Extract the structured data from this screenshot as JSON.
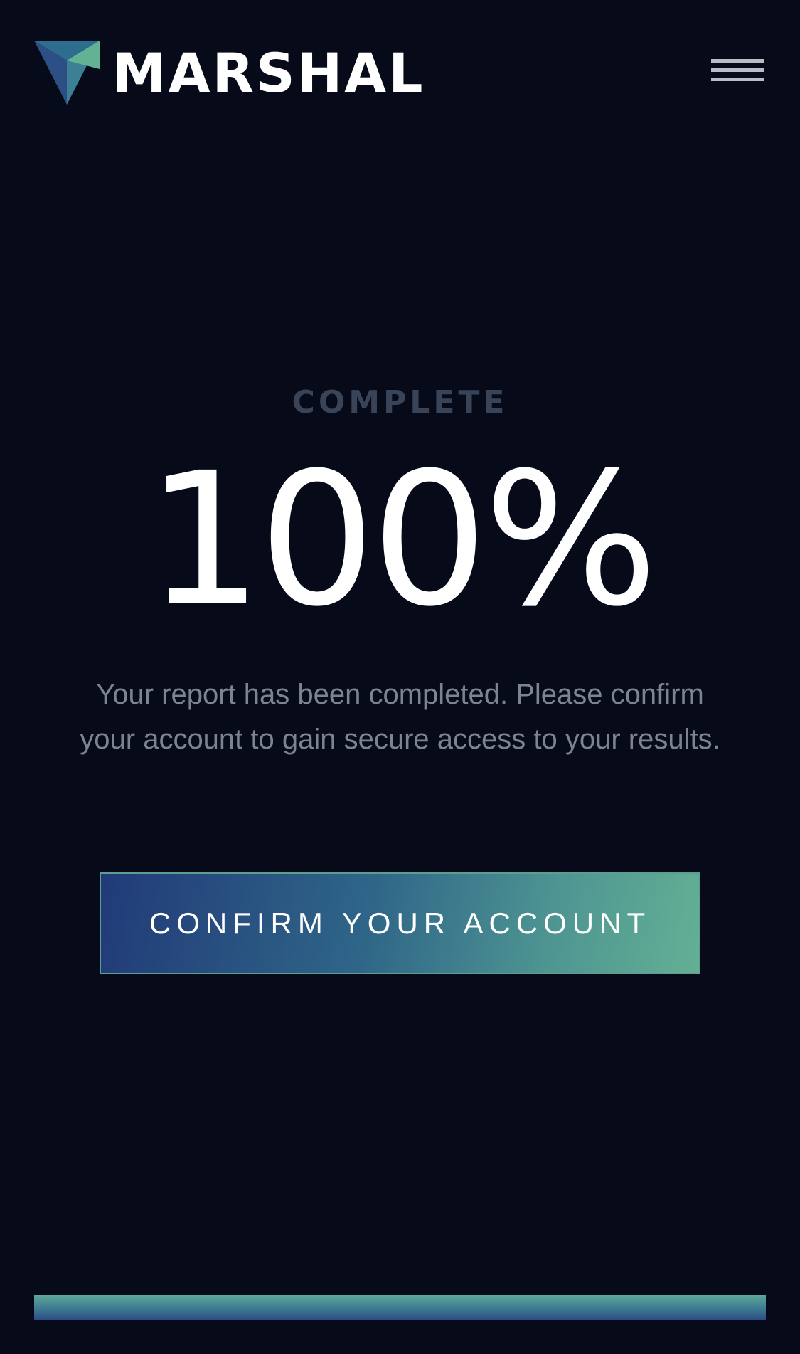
{
  "header": {
    "brand_name": "MARSHAL",
    "logo_icon": "marshal-shield-logo",
    "menu_icon": "hamburger-menu-icon"
  },
  "main": {
    "status_label": "COMPLETE",
    "progress_text": "100%",
    "progress_value": 100,
    "message": "Your report has been completed. Please confirm your account to gain secure access to your results.",
    "cta_label": "CONFIRM YOUR ACCOUNT"
  },
  "colors": {
    "background": "#070b19",
    "brand_teal": "#63b094",
    "brand_navy": "#213a78",
    "label_gray": "#3a4458",
    "message_gray": "#7d8391"
  }
}
